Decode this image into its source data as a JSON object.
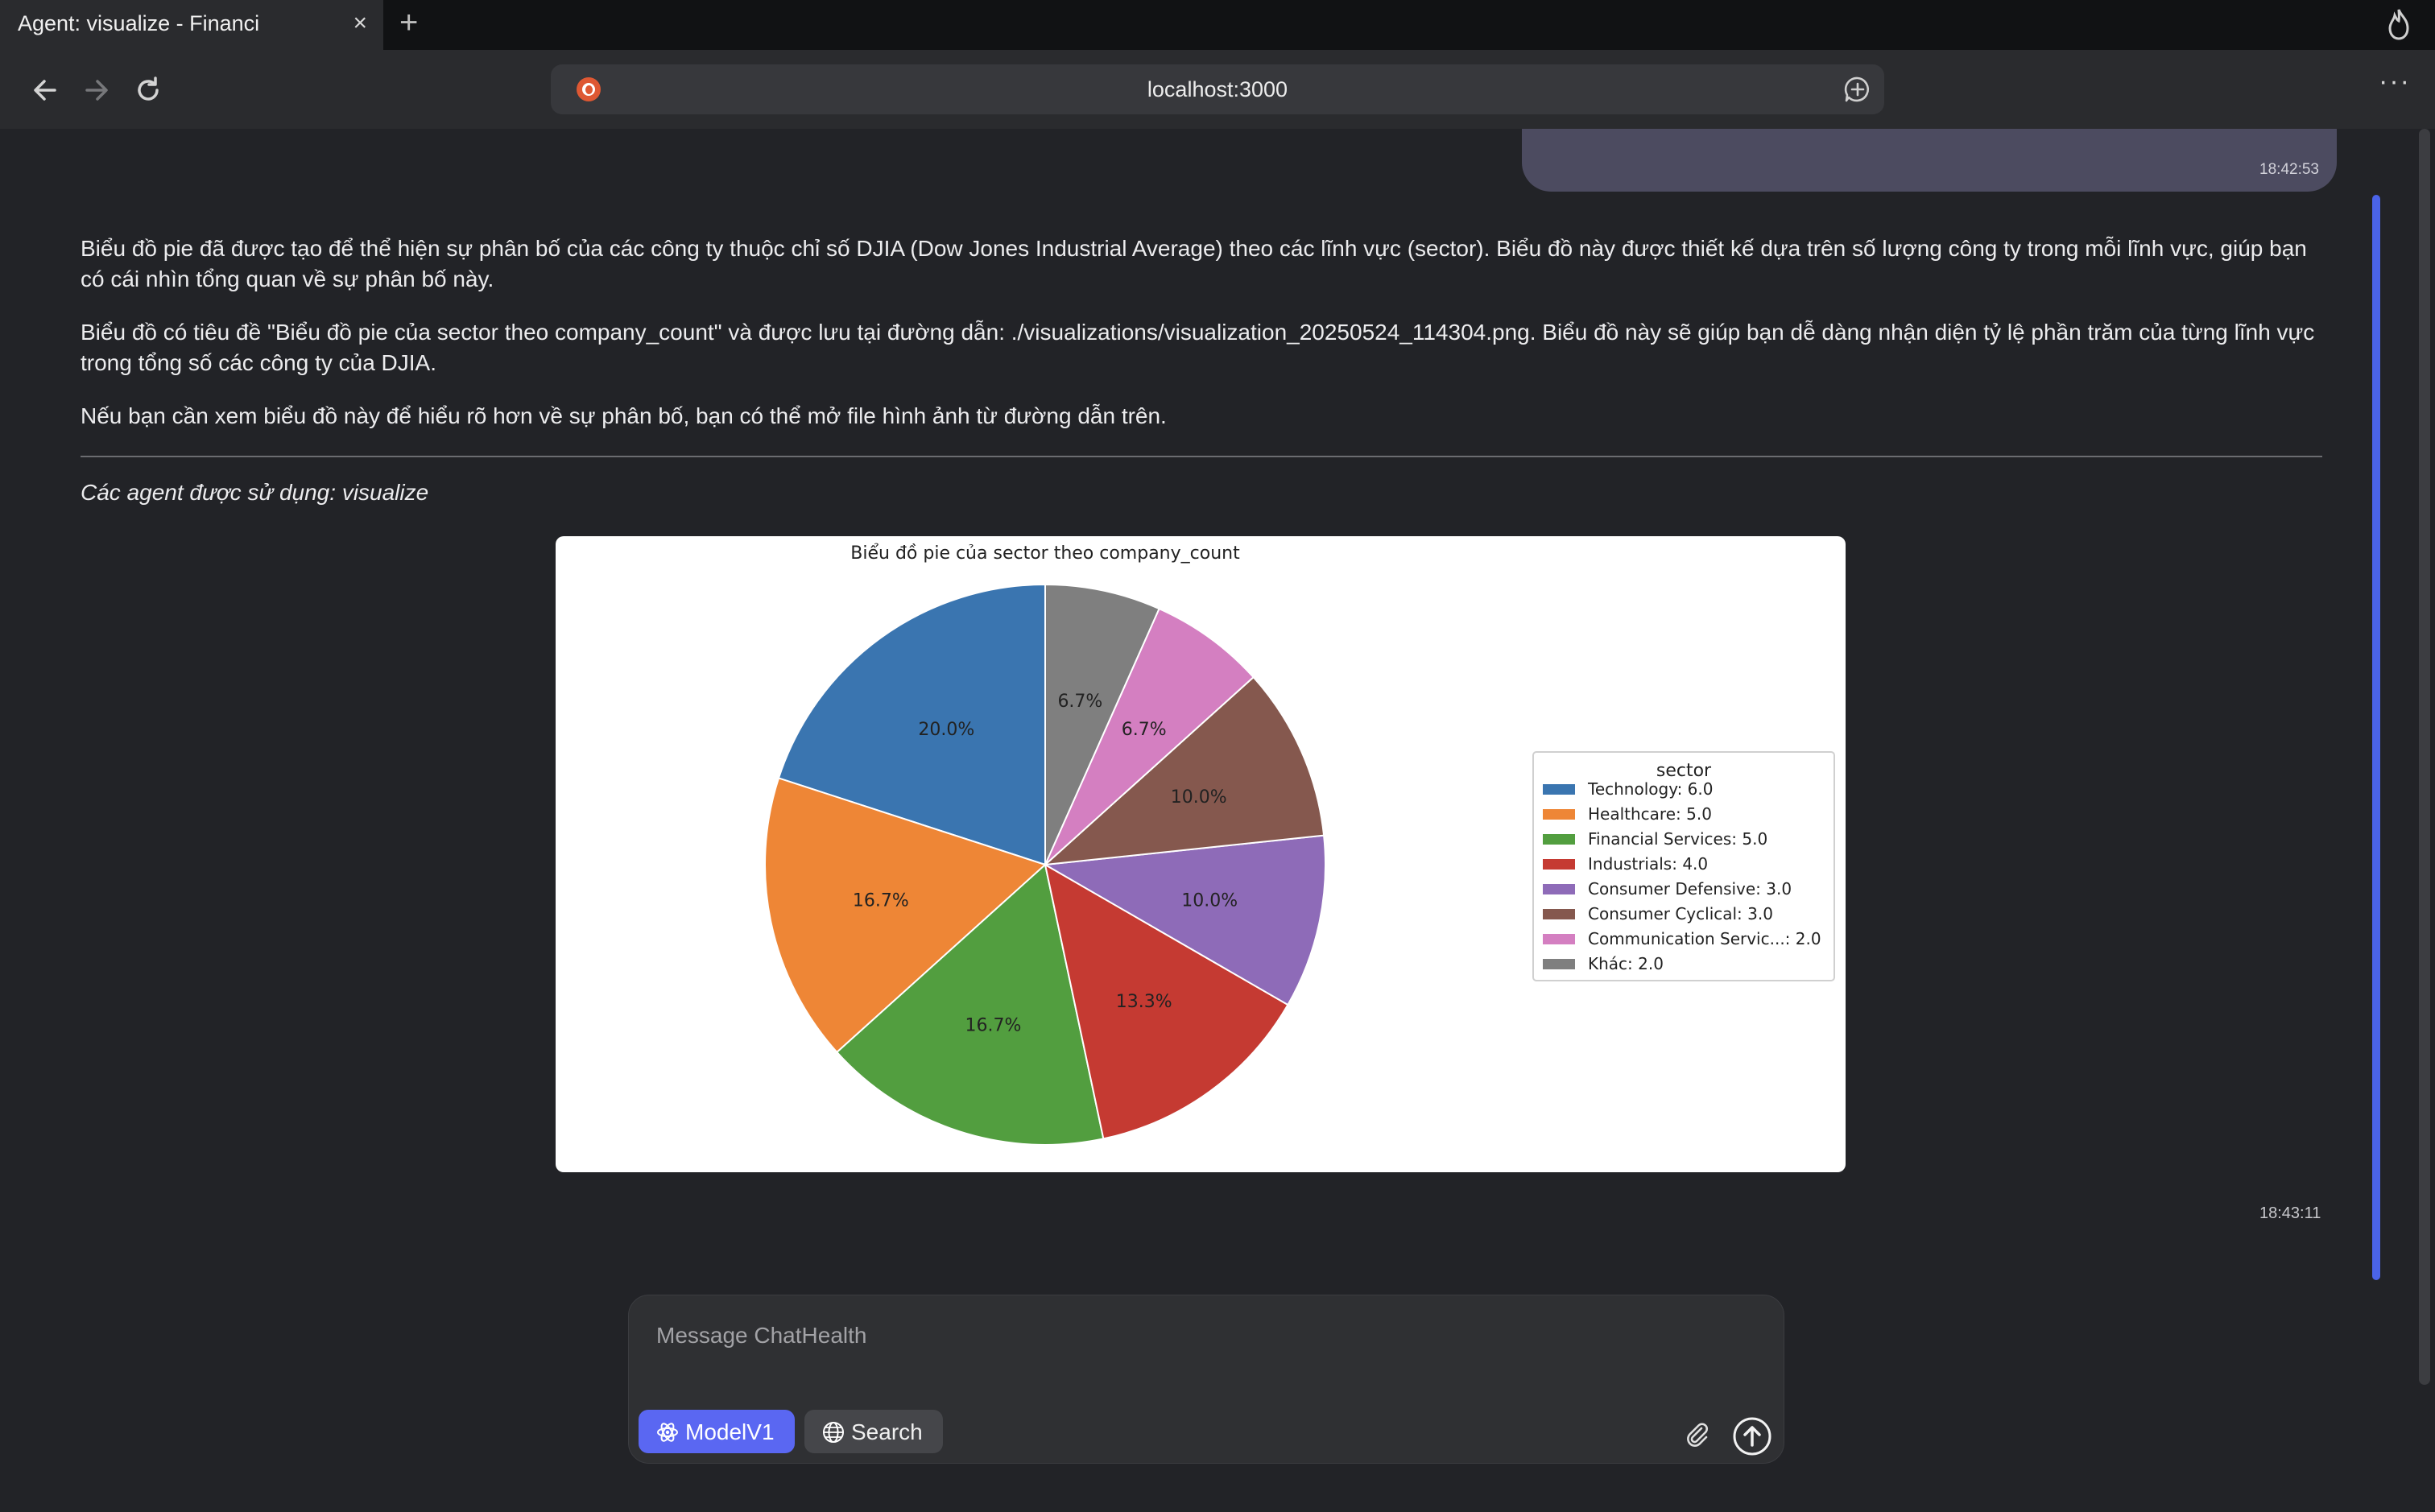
{
  "browser": {
    "tab_title": "Agent: visualize - Financi",
    "tab_close": "×",
    "new_tab": "+",
    "url": "localhost:3000",
    "menu": "···"
  },
  "chat": {
    "user_time": "18:42:53",
    "assistant_paragraphs": [
      "Biểu đồ pie đã được tạo để thể hiện sự phân bố của các công ty thuộc chỉ số DJIA (Dow Jones Industrial Average) theo các lĩnh vực (sector). Biểu đồ này được thiết kế dựa trên số lượng công ty trong mỗi lĩnh vực, giúp bạn có cái nhìn tổng quan về sự phân bố này.",
      "Biểu đồ có tiêu đề \"Biểu đồ pie của sector theo company_count\" và được lưu tại đường dẫn: ./visualizations/visualization_20250524_114304.png. Biểu đồ này sẽ giúp bạn dễ dàng nhận diện tỷ lệ phần trăm của từng lĩnh vực trong tổng số các công ty của DJIA.",
      "Nếu bạn cần xem biểu đồ này để hiểu rõ hơn về sự phân bố, bạn có thể mở file hình ảnh từ đường dẫn trên."
    ],
    "agents_used": "Các agent được sử dụng: visualize",
    "assistant_time": "18:43:11"
  },
  "composer": {
    "placeholder": "Message ChatHealth",
    "model_label": "ModelV1",
    "search_label": "Search"
  },
  "chart_data": {
    "type": "pie",
    "title": "Biểu đồ pie của sector theo company_count",
    "legend_title": "sector",
    "legend_position": "right",
    "slices": [
      {
        "label": "Technology: 6.0",
        "value": 6.0,
        "pct": "20.0%",
        "color": "#3a75b0"
      },
      {
        "label": "Healthcare: 5.0",
        "value": 5.0,
        "pct": "16.7%",
        "color": "#ee8636"
      },
      {
        "label": "Financial Services: 5.0",
        "value": 5.0,
        "pct": "16.7%",
        "color": "#529e3f"
      },
      {
        "label": "Industrials: 4.0",
        "value": 4.0,
        "pct": "13.3%",
        "color": "#c53a32"
      },
      {
        "label": "Consumer Defensive: 3.0",
        "value": 3.0,
        "pct": "10.0%",
        "color": "#8e6bb8"
      },
      {
        "label": "Consumer Cyclical: 3.0",
        "value": 3.0,
        "pct": "10.0%",
        "color": "#85584e"
      },
      {
        "label": "Communication Servic...: 2.0",
        "value": 2.0,
        "pct": "6.7%",
        "color": "#d47fc1"
      },
      {
        "label": "Khác: 2.0",
        "value": 2.0,
        "pct": "6.7%",
        "color": "#7f7f7f"
      }
    ]
  }
}
